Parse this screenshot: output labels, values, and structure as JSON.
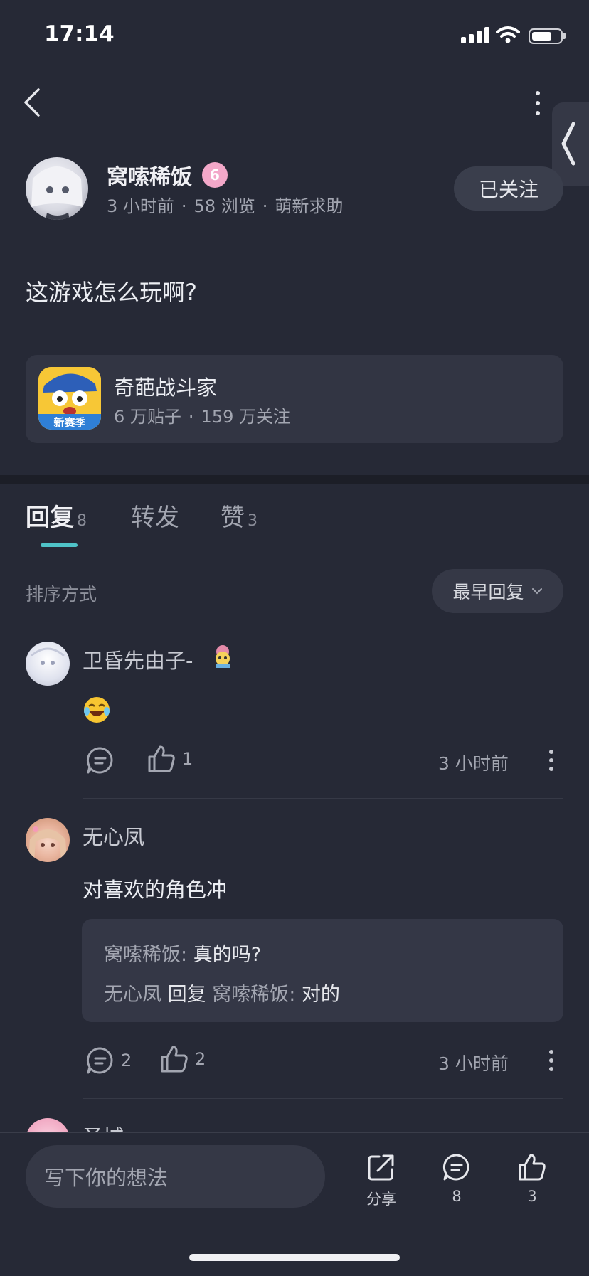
{
  "status_bar": {
    "time": "17:14",
    "battery_level": 0.7
  },
  "author": {
    "name": "窝嗦稀饭",
    "level_badge": "6",
    "time_ago": "3 小时前",
    "views": "58 浏览",
    "category": "萌新求助",
    "follow_label": "已关注"
  },
  "post": {
    "text": "这游戏怎么玩啊?"
  },
  "game": {
    "name": "奇葩战斗家",
    "posts": "6 万贴子",
    "followers": "159 万关注",
    "icon_badge": "新赛季"
  },
  "tabs": [
    {
      "label": "回复",
      "count": "8"
    },
    {
      "label": "转发",
      "count": ""
    },
    {
      "label": "赞",
      "count": "3"
    }
  ],
  "sort": {
    "label": "排序方式",
    "value": "最早回复"
  },
  "comments": [
    {
      "name": "卫昏先由子-",
      "text": "😂",
      "reply_count": "",
      "like_count": "1",
      "time": "3 小时前"
    },
    {
      "name": "无心凤",
      "text": "对喜欢的角色冲",
      "reply_count": "2",
      "like_count": "2",
      "time": "3 小时前",
      "replies": [
        {
          "author": "窝嗦稀饭",
          "separator": ":",
          "text": "真的吗?"
        },
        {
          "author": "无心凤",
          "reply_word": "回复",
          "target": "窝嗦稀饭",
          "separator": ":",
          "text": "对的"
        }
      ]
    },
    {
      "name": "圣城"
    }
  ],
  "bottom_bar": {
    "compose_placeholder": "写下你的想法",
    "share_label": "分享",
    "comment_count": "8",
    "like_count": "3"
  },
  "colors": {
    "background": "#262936",
    "accent": "#4fc3c8",
    "badge": "#f3a8c9"
  }
}
